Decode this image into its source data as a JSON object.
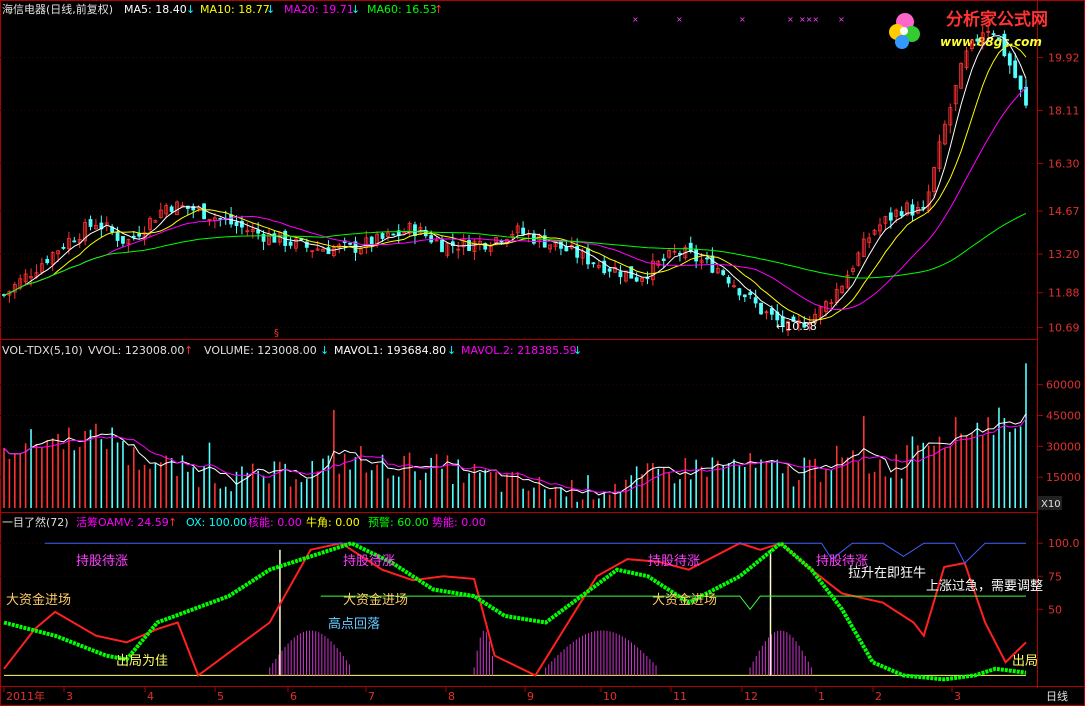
{
  "title_bar": {
    "stock": "海信电器(日线,前复权)",
    "ma5": "MA5: 18.40",
    "ma10": "MA10: 18.77",
    "ma20": "MA20: 19.71",
    "ma60": "MA60: 16.53"
  },
  "logo": {
    "name": "分析家公式网",
    "url": "www.88gs.com"
  },
  "vol_bar": {
    "name": "VOL-TDX(5,10)",
    "vvol": "VVOL: 123008.00",
    "volume": "VOLUME: 123008.00",
    "mavol1": "MAVOL1: 193684.80",
    "mavol2": "MAVOL.2: 218385.59",
    "unit": "X10"
  },
  "ind_bar": {
    "name": "一目了然(72)",
    "oamv": "活筹OAMV: 24.59",
    "ox": "OX: 100.00",
    "core": "核能: 0.00",
    "niujiao": "牛角: 0.00",
    "warn": "预警: 60.00",
    "shi": "势能: 0.00"
  },
  "period": "日线",
  "low_marker": "←10.38",
  "colors": {
    "up": "#ff3232",
    "down": "#54ffff",
    "ma5": "#ffffff",
    "ma10": "#ffff00",
    "ma20": "#ff00ff",
    "ma60": "#00ff00",
    "axis": "#b00000",
    "text_cyan": "#00ffff"
  },
  "chart_data": [
    {
      "type": "candlestick",
      "title": "海信电器(日线,前复权)",
      "price_ticks": [
        19.92,
        18.11,
        16.3,
        14.67,
        13.2,
        11.88,
        10.69
      ],
      "ylim": [
        10.4,
        21.2
      ],
      "low_label": 10.38,
      "key_points": [
        {
          "t": 0,
          "p": 11.8
        },
        {
          "t": 0.06,
          "p": 13.6
        },
        {
          "t": 0.09,
          "p": 14.3
        },
        {
          "t": 0.12,
          "p": 13.6
        },
        {
          "t": 0.16,
          "p": 14.9
        },
        {
          "t": 0.19,
          "p": 14.7
        },
        {
          "t": 0.24,
          "p": 14.0
        },
        {
          "t": 0.3,
          "p": 13.4
        },
        {
          "t": 0.34,
          "p": 13.4
        },
        {
          "t": 0.38,
          "p": 13.8
        },
        {
          "t": 0.4,
          "p": 14.1
        },
        {
          "t": 0.43,
          "p": 13.5
        },
        {
          "t": 0.47,
          "p": 13.6
        },
        {
          "t": 0.5,
          "p": 14.0
        },
        {
          "t": 0.54,
          "p": 13.5
        },
        {
          "t": 0.58,
          "p": 12.9
        },
        {
          "t": 0.62,
          "p": 12.4
        },
        {
          "t": 0.66,
          "p": 13.3
        },
        {
          "t": 0.7,
          "p": 12.7
        },
        {
          "t": 0.74,
          "p": 11.3
        },
        {
          "t": 0.77,
          "p": 10.6
        },
        {
          "t": 0.8,
          "p": 11.3
        },
        {
          "t": 0.82,
          "p": 12.2
        },
        {
          "t": 0.85,
          "p": 14.0
        },
        {
          "t": 0.88,
          "p": 14.8
        },
        {
          "t": 0.9,
          "p": 14.6
        },
        {
          "t": 0.92,
          "p": 17.5
        },
        {
          "t": 0.94,
          "p": 19.9
        },
        {
          "t": 0.96,
          "p": 21.0
        },
        {
          "t": 0.97,
          "p": 20.8
        },
        {
          "t": 0.99,
          "p": 19.2
        },
        {
          "t": 1,
          "p": 18.2
        }
      ]
    },
    {
      "type": "bar",
      "title": "VOL-TDX(5,10)",
      "volume_ticks": [
        60000,
        45000,
        30000,
        15000
      ],
      "ylim": [
        0,
        72000
      ]
    },
    {
      "type": "line",
      "title": "一目了然(72)",
      "ticks": [
        100.0,
        75,
        50
      ],
      "ylim": [
        -5,
        110
      ],
      "series": [
        {
          "name": "活筹OAMV",
          "color": "#ff2020",
          "points": [
            {
              "t": 0,
              "v": 5
            },
            {
              "t": 0.03,
              "v": 35
            },
            {
              "t": 0.05,
              "v": 48
            },
            {
              "t": 0.09,
              "v": 30
            },
            {
              "t": 0.12,
              "v": 25
            },
            {
              "t": 0.15,
              "v": 35
            },
            {
              "t": 0.17,
              "v": 40
            },
            {
              "t": 0.19,
              "v": 0
            },
            {
              "t": 0.26,
              "v": 40
            },
            {
              "t": 0.3,
              "v": 95
            },
            {
              "t": 0.33,
              "v": 100
            },
            {
              "t": 0.37,
              "v": 80
            },
            {
              "t": 0.4,
              "v": 72
            },
            {
              "t": 0.43,
              "v": 75
            },
            {
              "t": 0.46,
              "v": 73
            },
            {
              "t": 0.48,
              "v": 15
            },
            {
              "t": 0.52,
              "v": 0
            },
            {
              "t": 0.58,
              "v": 75
            },
            {
              "t": 0.61,
              "v": 88
            },
            {
              "t": 0.64,
              "v": 86
            },
            {
              "t": 0.67,
              "v": 80
            },
            {
              "t": 0.72,
              "v": 100
            },
            {
              "t": 0.74,
              "v": 95
            },
            {
              "t": 0.76,
              "v": 100
            },
            {
              "t": 0.79,
              "v": 80
            },
            {
              "t": 0.82,
              "v": 62
            },
            {
              "t": 0.86,
              "v": 55
            },
            {
              "t": 0.89,
              "v": 40
            },
            {
              "t": 0.9,
              "v": 30
            },
            {
              "t": 0.92,
              "v": 82
            },
            {
              "t": 0.94,
              "v": 85
            },
            {
              "t": 0.96,
              "v": 40
            },
            {
              "t": 0.98,
              "v": 10
            },
            {
              "t": 1,
              "v": 25
            }
          ]
        },
        {
          "name": "OX",
          "color": "#4060ff",
          "points": [
            {
              "t": 0.04,
              "v": 100
            },
            {
              "t": 0.78,
              "v": 100
            },
            {
              "t": 0.8,
              "v": 100
            },
            {
              "t": 0.81,
              "v": 88
            },
            {
              "t": 0.83,
              "v": 100
            },
            {
              "t": 0.86,
              "v": 100
            },
            {
              "t": 0.88,
              "v": 90
            },
            {
              "t": 0.9,
              "v": 100
            },
            {
              "t": 0.93,
              "v": 100
            },
            {
              "t": 0.94,
              "v": 85
            },
            {
              "t": 0.96,
              "v": 100
            },
            {
              "t": 1,
              "v": 100
            }
          ]
        },
        {
          "name": "预警",
          "color": "#3cff3c",
          "points": [
            {
              "t": 0.31,
              "v": 60
            },
            {
              "t": 0.72,
              "v": 60
            },
            {
              "t": 0.73,
              "v": 50
            },
            {
              "t": 0.74,
              "v": 60
            },
            {
              "t": 1,
              "v": 60
            }
          ]
        },
        {
          "name": "绿阶梯",
          "color": "#00ff00",
          "points": [
            {
              "t": 0,
              "v": 40
            },
            {
              "t": 0.05,
              "v": 30
            },
            {
              "t": 0.1,
              "v": 15
            },
            {
              "t": 0.12,
              "v": 12
            },
            {
              "t": 0.15,
              "v": 40
            },
            {
              "t": 0.22,
              "v": 60
            },
            {
              "t": 0.26,
              "v": 80
            },
            {
              "t": 0.34,
              "v": 100
            },
            {
              "t": 0.38,
              "v": 85
            },
            {
              "t": 0.42,
              "v": 65
            },
            {
              "t": 0.46,
              "v": 60
            },
            {
              "t": 0.49,
              "v": 45
            },
            {
              "t": 0.53,
              "v": 40
            },
            {
              "t": 0.6,
              "v": 80
            },
            {
              "t": 0.63,
              "v": 75
            },
            {
              "t": 0.67,
              "v": 55
            },
            {
              "t": 0.72,
              "v": 75
            },
            {
              "t": 0.76,
              "v": 100
            },
            {
              "t": 0.79,
              "v": 80
            },
            {
              "t": 0.82,
              "v": 50
            },
            {
              "t": 0.85,
              "v": 10
            },
            {
              "t": 0.88,
              "v": 0
            },
            {
              "t": 0.92,
              "v": -3
            },
            {
              "t": 0.95,
              "v": 0
            },
            {
              "t": 0.97,
              "v": 5
            },
            {
              "t": 1,
              "v": 2
            }
          ]
        }
      ],
      "annotations": [
        "持股待涨",
        "持股待涨",
        "持股待涨",
        "持股待涨",
        "大资金进场",
        "大资金进场",
        "大资金进场",
        "高点回落",
        "出局为佳",
        "拉升在即狂牛",
        "上涨过急，需要调整",
        "出局"
      ]
    }
  ],
  "date_axis": [
    "2011年",
    "3",
    "4",
    "5",
    "6",
    "7",
    "8",
    "9",
    "10",
    "11",
    "12",
    "1",
    "2",
    "3"
  ]
}
